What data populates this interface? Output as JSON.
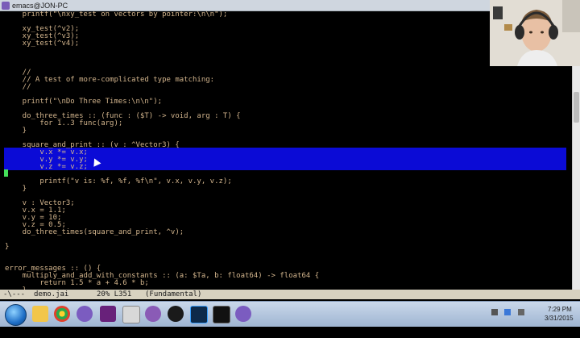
{
  "window": {
    "title": "emacs@JON-PC"
  },
  "editor": {
    "lines": [
      "    printf(\"\\nxy_test on vectors by pointer:\\n\\n\");",
      "",
      "    xy_test(^v2);",
      "    xy_test(^v3);",
      "    xy_test(^v4);",
      "",
      "",
      "",
      "    //",
      "    // A test of more-complicated type matching:",
      "    //",
      "",
      "    printf(\"\\nDo Three Times:\\n\\n\");",
      "",
      "    do_three_times :: (func : ($T) -> void, arg : T) {",
      "        for 1..3 func(arg);",
      "    }",
      "",
      "    square_and_print :: (v : ^Vector3) {",
      "        v.x *= v.x;",
      "        v.y *= v.y;",
      "        v.z *= v.z;",
      "",
      "        printf(\"v is: %f, %f, %f\\n\", v.x, v.y, v.z);",
      "    }",
      "",
      "    v : Vector3;",
      "    v.x = 1.1;",
      "    v.y = 10;",
      "    v.z = 0.5;",
      "    do_three_times(square_and_print, ^v);",
      "",
      "}",
      "",
      "",
      "error_messages :: () {",
      "    multiply_and_add_with_constants :: (a: $Ta, b: float64) -> float64 {",
      "        return 1.5 * a + 4.6 * b;",
      "    }"
    ]
  },
  "modeline": {
    "status": "-\\---",
    "filename": "demo.jai",
    "position": "20% L351",
    "mode": "(Fundamental)"
  },
  "taskbar": {
    "time": "7:29 PM",
    "date": "3/31/2015"
  },
  "colors": {
    "code": "#d3b58d",
    "selection": "#0b0bd6",
    "cursor": "#45e05a",
    "modeline_bg": "#d8d2c0"
  }
}
